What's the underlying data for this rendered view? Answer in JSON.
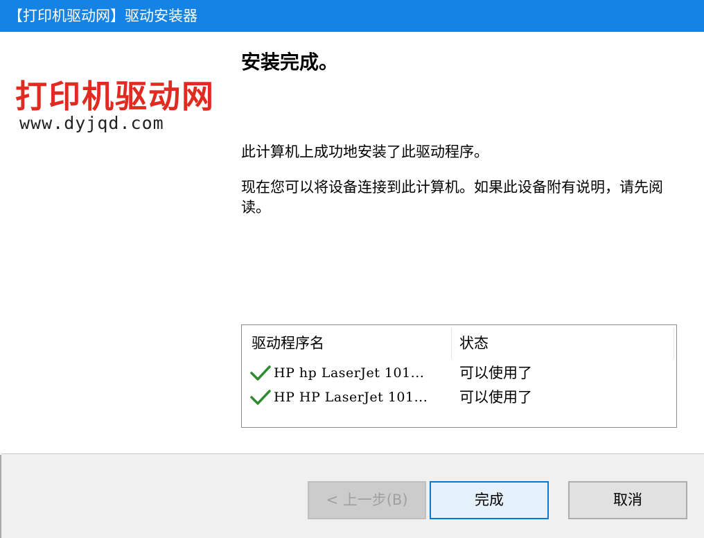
{
  "window": {
    "title": "【打印机驱动网】驱动安装器"
  },
  "logo": {
    "main_text": "打印机驱动网",
    "url_text": "www.dyjqd.com"
  },
  "content": {
    "heading": "安装完成。",
    "message_1": "此计算机上成功地安装了此驱动程序。",
    "message_2": "现在您可以将设备连接到此计算机。如果此设备附有说明，请先阅读。"
  },
  "driver_list": {
    "columns": {
      "name": "驱动程序名",
      "status": "状态"
    },
    "rows": [
      {
        "name": "HP hp LaserJet 101...",
        "status": "可以使用了",
        "icon": "check-icon"
      },
      {
        "name": "HP HP LaserJet 101...",
        "status": "可以使用了",
        "icon": "check-icon"
      }
    ]
  },
  "buttons": {
    "back": "< 上一步(B)",
    "finish": "完成",
    "cancel": "取消"
  },
  "colors": {
    "titlebar": "#1583e3",
    "logo_red": "#e12a20",
    "check_green": "#2e8b2e",
    "focus_border": "#0078d7"
  }
}
